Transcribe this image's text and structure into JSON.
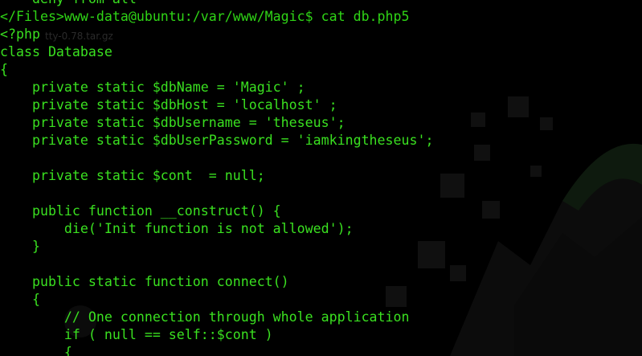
{
  "terminal": {
    "lines": [
      "    deny from all",
      "</Files>www-data@ubuntu:/var/www/Magic$ cat db.php5",
      "<?php",
      "class Database",
      "{",
      "    private static $dbName = 'Magic' ;",
      "    private static $dbHost = 'localhost' ;",
      "    private static $dbUsername = 'theseus';",
      "    private static $dbUserPassword = 'iamkingtheseus';",
      "",
      "    private static $cont  = null;",
      "",
      "    public function __construct() {",
      "        die('Init function is not allowed');",
      "    }",
      "",
      "    public static function connect()",
      "    {",
      "        // One connection through whole application",
      "        if ( null == self::$cont )",
      "        {"
    ]
  },
  "background": {
    "ghost_label": "tty-0.78.tar.gz",
    "colors": {
      "terminal_bg": "#000000",
      "text": "#3ae020",
      "wallpaper_shape": "#0d0d0d"
    }
  }
}
